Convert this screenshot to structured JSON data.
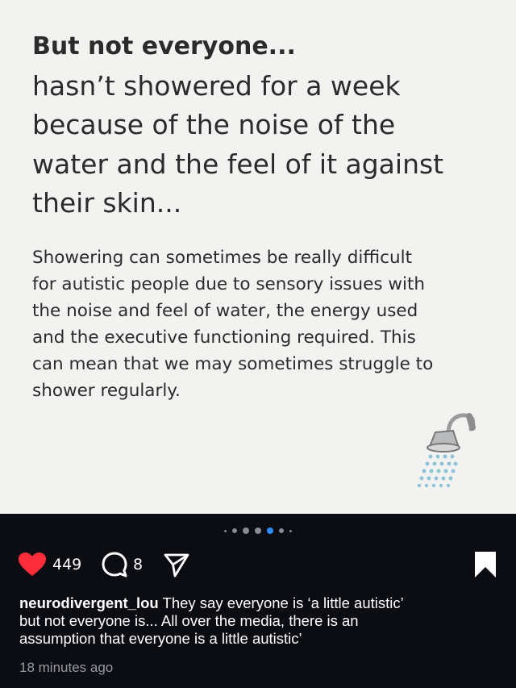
{
  "slide": {
    "headline_bold": "But not everyone...",
    "headline_lines": [
      "hasn’t showered for a week",
      "because of the noise of the",
      "water and the feel of it against",
      "their skin..."
    ],
    "body_lines": [
      "Showering can sometimes be really difficult",
      "for autistic people due to sensory issues with",
      "the noise and feel of water, the energy used",
      "and the executive functioning required. This",
      "can mean that we may sometimes struggle to",
      "shower regularly."
    ],
    "illustration_icon": "shower-head-icon"
  },
  "carousel": {
    "total_dots": 7,
    "active_index": 4
  },
  "actions": {
    "like_count": "449",
    "comment_count": "8",
    "like_color": "#ff2d3b"
  },
  "post": {
    "username": "neurodivergent_lou",
    "caption_lines": [
      "They say everyone is ‘a little autistic’",
      "but not everyone is... All over the media, there is an",
      "assumption that everyone is a little autistic’"
    ],
    "timestamp": "18 minutes ago"
  }
}
